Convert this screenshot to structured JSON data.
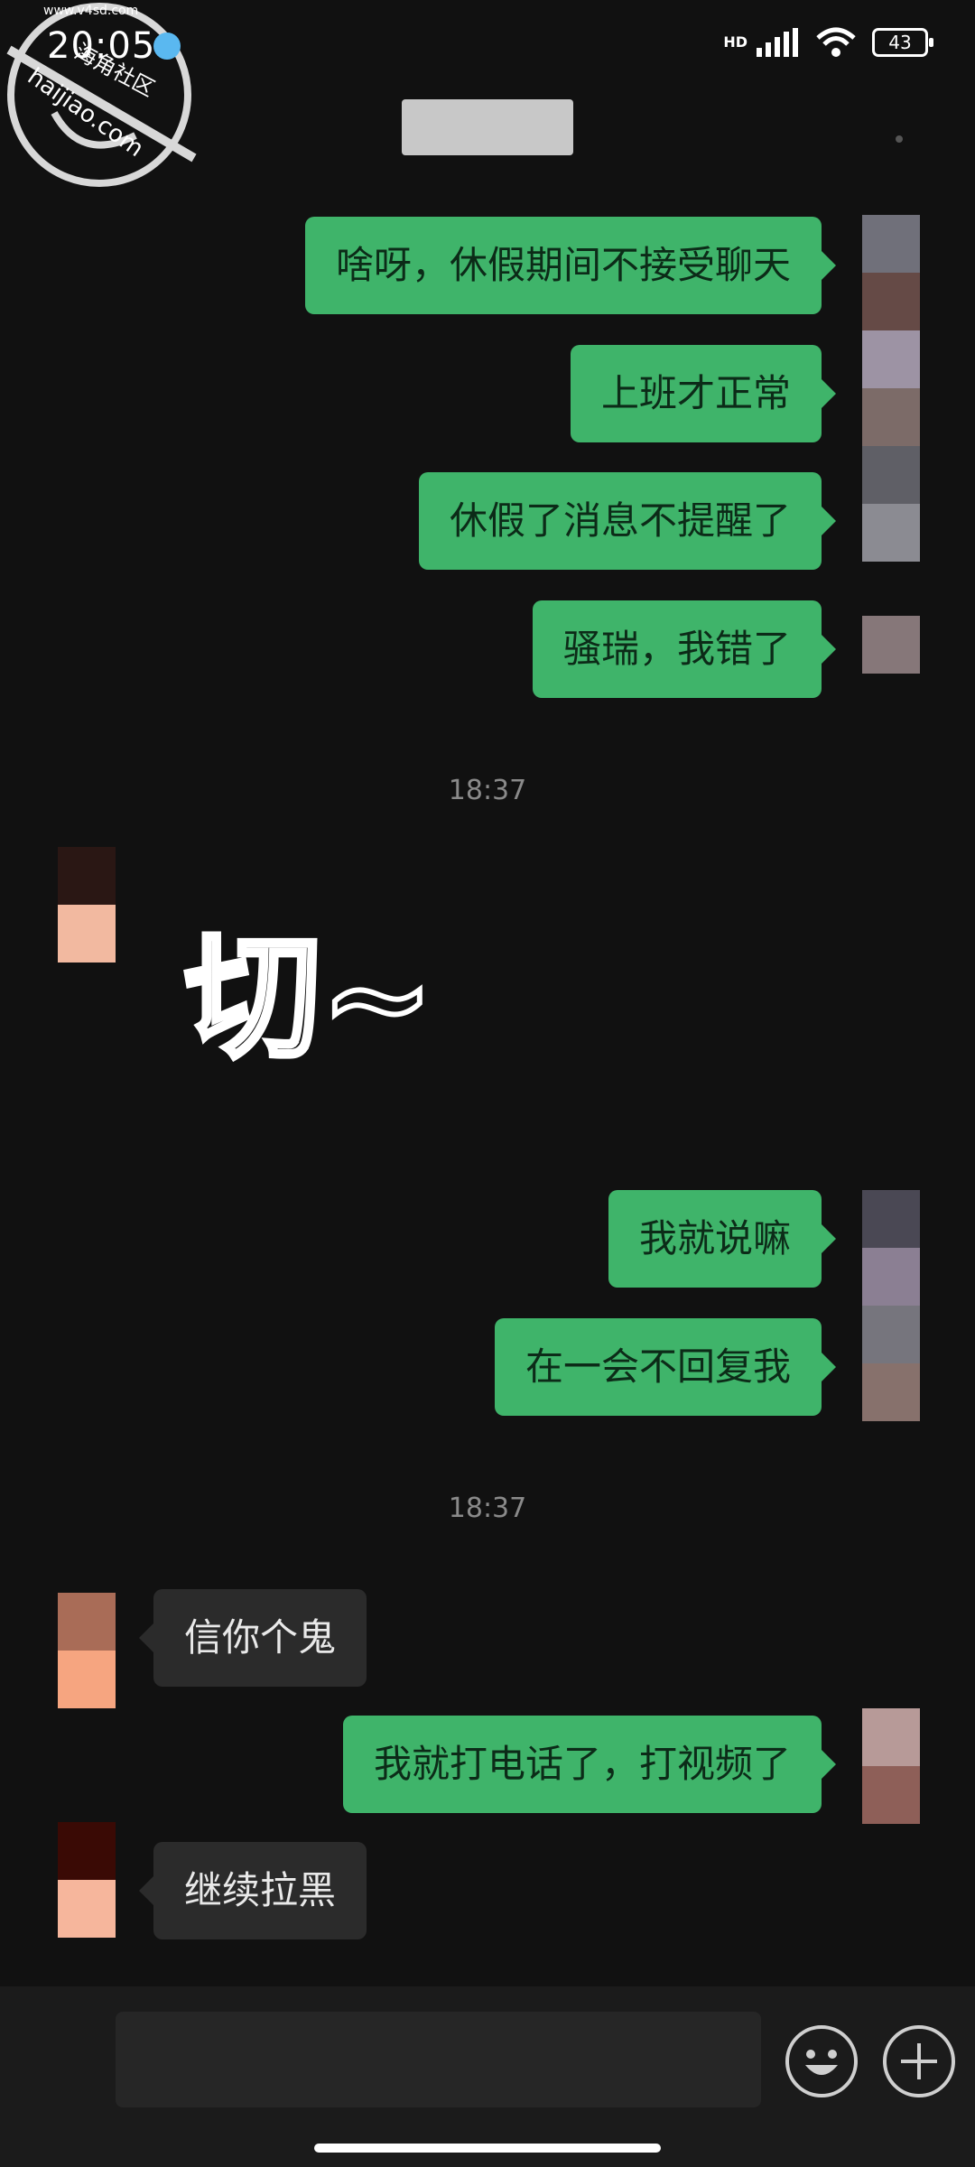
{
  "status_bar": {
    "time": "20:05",
    "network": "HD",
    "battery": "43"
  },
  "watermark": {
    "lines": [
      "海角社区",
      "haijiao.com",
      "www.v4sd.com"
    ]
  },
  "messages": [
    {
      "side": "right",
      "text": "啥呀，休假期间不接受聊天"
    },
    {
      "side": "right",
      "text": "上班才正常"
    },
    {
      "side": "right",
      "text": "休假了消息不提醒了"
    },
    {
      "side": "right",
      "text": "骚瑞，我错了"
    },
    {
      "type": "timestamp",
      "text": "18:37"
    },
    {
      "side": "left",
      "type": "sticker",
      "text": "切~"
    },
    {
      "side": "right",
      "text": "我就说嘛"
    },
    {
      "side": "right",
      "text": "在一会不回复我"
    },
    {
      "type": "timestamp",
      "text": "18:37"
    },
    {
      "side": "left",
      "text": "信你个鬼"
    },
    {
      "side": "right",
      "text": "我就打电话了，打视频了"
    },
    {
      "side": "left",
      "text": "继续拉黑"
    }
  ],
  "input_bar": {
    "icons": [
      "emoji-icon",
      "plus-icon"
    ]
  },
  "colors": {
    "bubble_sent": "#3fb46a",
    "bubble_received": "#2b2b2b",
    "background": "#111111"
  }
}
